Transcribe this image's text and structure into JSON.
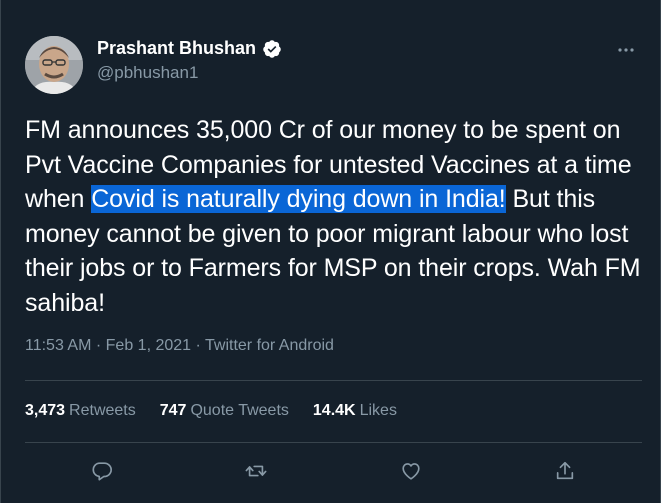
{
  "author": {
    "display_name": "Prashant Bhushan",
    "handle": "@pbhushan1",
    "verified": true
  },
  "tweet": {
    "text_part1": "FM announces 35,000 Cr of our money to be spent on Pvt Vaccine Companies for untested Vaccines at a time when ",
    "text_highlight_line1": "Covid is naturally dying down in ",
    "text_highlight_line2": "India!",
    "text_part2": " But this money cannot be given to poor migrant labour who lost their jobs or to Farmers for MSP on their crops. Wah FM sahiba!"
  },
  "meta": {
    "time": "11:53 AM",
    "separator": "·",
    "date": "Feb 1, 2021",
    "source": "Twitter for Android"
  },
  "stats": {
    "retweets_count": "3,473",
    "retweets_label": "Retweets",
    "quotes_count": "747",
    "quotes_label": "Quote Tweets",
    "likes_count": "14.4K",
    "likes_label": "Likes"
  },
  "icons": {
    "more": "more-dots-icon",
    "reply": "reply-icon",
    "retweet": "retweet-icon",
    "like": "heart-icon",
    "share": "share-icon",
    "verified": "verified-badge-icon"
  },
  "colors": {
    "background": "#15202b",
    "secondary_text": "#8899a6",
    "divider": "#38444d",
    "selection": "#0a66d6",
    "verified_badge": "#ffffff"
  }
}
